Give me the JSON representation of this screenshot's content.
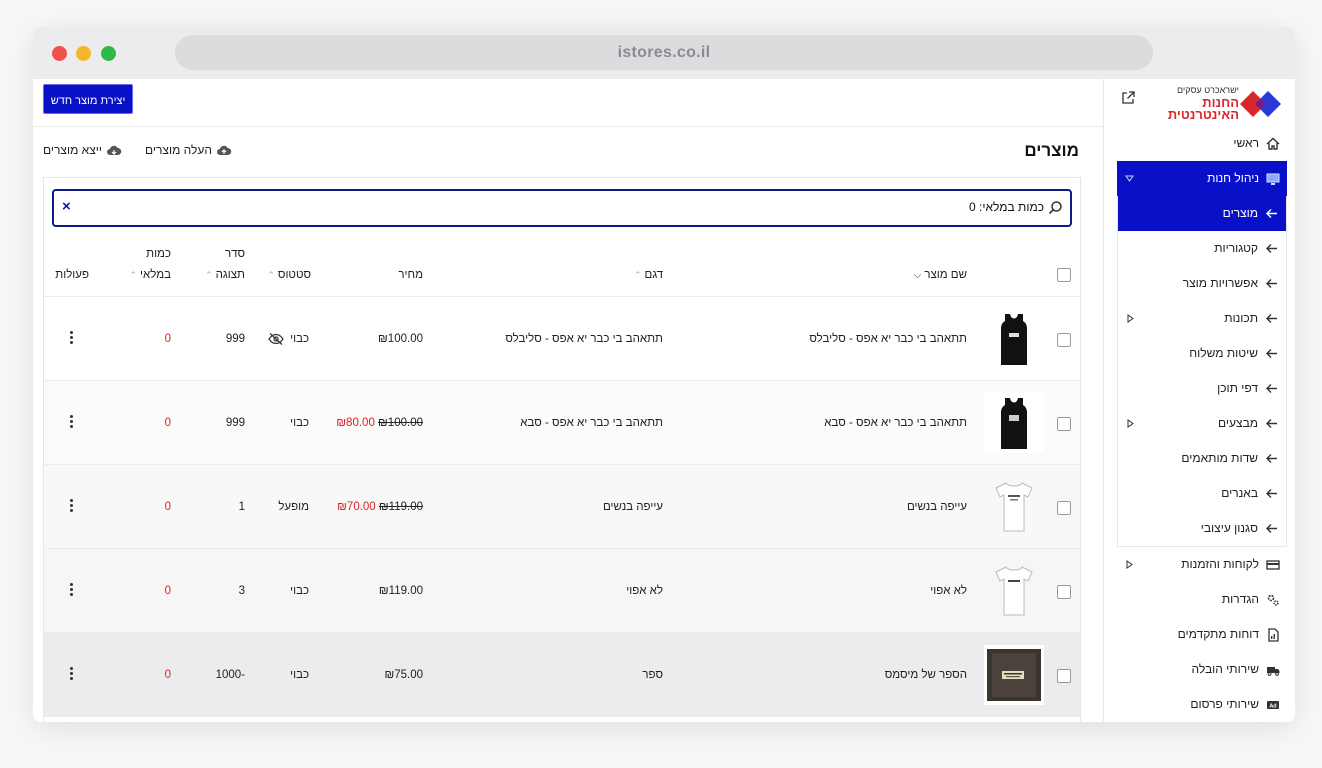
{
  "browser": {
    "url": "istores.co.il"
  },
  "brand": {
    "line1": "ישראכרט עסקים",
    "line2": "החנות",
    "line3": "האינטרנטית"
  },
  "sidebar": {
    "home": "ראשי",
    "store_mgmt": "ניהול חנות",
    "store_sub": [
      "מוצרים",
      "קטגוריות",
      "אפשרויות מוצר",
      "תכונות",
      "שיטות משלוח",
      "דפי תוכן",
      "מבצעים",
      "שדות מותאמים",
      "באנרים",
      "סגנון עיצובי"
    ],
    "bottom": [
      "לקוחות והזמנות",
      "הגדרות",
      "דוחות מתקדמים",
      "שירותי הובלה",
      "שירותי פרסום"
    ]
  },
  "page": {
    "create_button": "יצירת מוצר חדש",
    "title": "מוצרים",
    "upload_label": "העלה מוצרים",
    "export_label": "ייצא מוצרים"
  },
  "search": {
    "value": "כמות במלאי: 0",
    "clear": "×"
  },
  "table": {
    "headers": {
      "name": "שם מוצר",
      "model": "דגם",
      "price": "מחיר",
      "status": "סטטוס",
      "order_line1": "סדר",
      "order_line2": "תצוגה",
      "stock_line1": "כמות",
      "stock_line2": "במלאי",
      "actions": "פעולות"
    },
    "rows": [
      {
        "name": "תתאהב בי כבר יא אפס - סליבלס",
        "model": "תתאהב בי כבר יא אפס - סליבלס",
        "price": "₪100.00",
        "old_price": "",
        "status": "כבוי",
        "hidden": true,
        "order": "999",
        "stock": "0",
        "thumb": "black-tank"
      },
      {
        "name": "תתאהב בי כבר יא אפס - סבא",
        "model": "תתאהב בי כבר יא אפס - סבא",
        "price": "₪80.00",
        "old_price": "₪100.00",
        "status": "כבוי",
        "hidden": false,
        "order": "999",
        "stock": "0",
        "thumb": "black-tank"
      },
      {
        "name": "עייפה בנשים",
        "model": "עייפה בנשים",
        "price": "₪70.00",
        "old_price": "₪119.00",
        "status": "מופעל",
        "hidden": false,
        "order": "1",
        "stock": "0",
        "thumb": "white-tee"
      },
      {
        "name": "לא אפוי",
        "model": "לא אפוי",
        "price": "₪119.00",
        "old_price": "",
        "status": "כבוי",
        "hidden": false,
        "order": "3",
        "stock": "0",
        "thumb": "white-tee"
      },
      {
        "name": "הספר של מיסמס",
        "model": "ספר",
        "price": "₪75.00",
        "old_price": "",
        "status": "כבוי",
        "hidden": false,
        "order": "-1000",
        "stock": "0",
        "thumb": "book"
      }
    ]
  },
  "colors": {
    "accent": "#0810c8",
    "sale": "#e02020",
    "brand_red": "#d8262b",
    "brand_blue": "#2a3ad8"
  }
}
